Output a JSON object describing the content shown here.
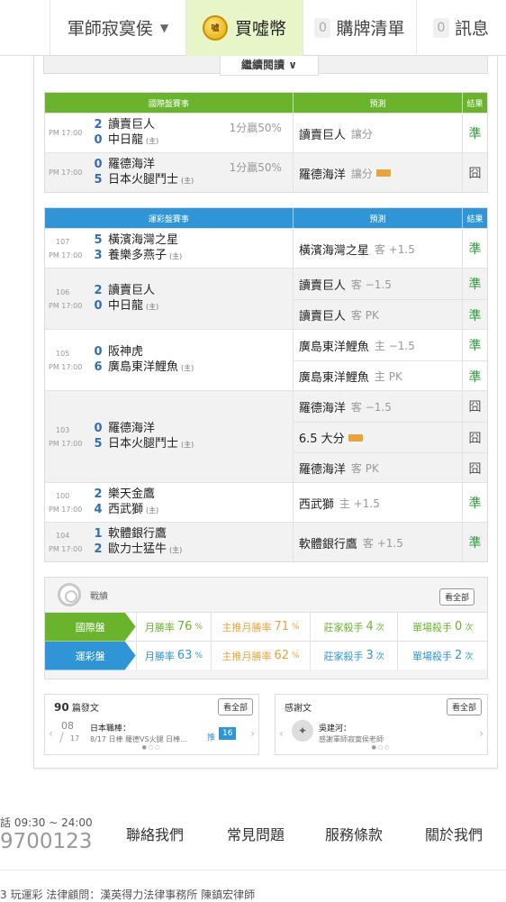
{
  "nav": {
    "user": "軍師寂寞侯",
    "buy_label": "買噓幣",
    "coin_text": "噓",
    "cart_count": "0",
    "cart_label": "購牌清單",
    "msg_count": "0",
    "msg_label": "訊息"
  },
  "read_more": "繼續閱讀",
  "intl": {
    "header": {
      "game": "國際盤賽事",
      "pred": "預測",
      "result": "結果"
    },
    "rows": [
      {
        "time": "PM 17:00",
        "s1": "2",
        "t1": "讀賣巨人",
        "s2": "0",
        "t2": "中日龍",
        "home": "(主)",
        "odds": "1分贏50%",
        "preds": [
          {
            "pick": "讀賣巨人",
            "sub": "讓分",
            "badge": false,
            "result": "準",
            "win": true
          }
        ]
      },
      {
        "time": "PM 17:00",
        "s1": "0",
        "t1": "羅德海洋",
        "s2": "5",
        "t2": "日本火腿鬥士",
        "home": "(主)",
        "odds": "1分贏50%",
        "preds": [
          {
            "pick": "羅德海洋",
            "sub": "讓分",
            "badge": true,
            "result": "囧",
            "win": false
          }
        ]
      }
    ]
  },
  "lottery": {
    "header": {
      "game": "運彩盤賽事",
      "pred": "預測",
      "result": "結果"
    },
    "rows": [
      {
        "num": "107",
        "time": "PM 17:00",
        "s1": "5",
        "t1": "橫濱海灣之星",
        "s2": "3",
        "t2": "養樂多燕子",
        "home": "(主)",
        "preds": [
          {
            "pick": "橫濱海灣之星",
            "sub": "客 +1.5",
            "result": "準"
          }
        ]
      },
      {
        "num": "106",
        "time": "PM 17:00",
        "s1": "2",
        "t1": "讀賣巨人",
        "s2": "0",
        "t2": "中日龍",
        "home": "(主)",
        "preds": [
          {
            "pick": "讀賣巨人",
            "sub": "客 −1.5",
            "result": "準"
          },
          {
            "pick": "讀賣巨人",
            "sub": "客 PK",
            "result": "準"
          }
        ]
      },
      {
        "num": "105",
        "time": "PM 17:00",
        "s1": "0",
        "t1": "阪神虎",
        "s2": "6",
        "t2": "廣島東洋鯉魚",
        "home": "(主)",
        "preds": [
          {
            "pick": "廣島東洋鯉魚",
            "sub": "主 −1.5",
            "result": "準"
          },
          {
            "pick": "廣島東洋鯉魚",
            "sub": "主 PK",
            "result": "準"
          }
        ]
      },
      {
        "num": "103",
        "time": "PM 17:00",
        "s1": "0",
        "t1": "羅德海洋",
        "s2": "5",
        "t2": "日本火腿鬥士",
        "home": "(主)",
        "preds": [
          {
            "pick": "羅德海洋",
            "sub": "客 −1.5",
            "result": "囧"
          },
          {
            "pick": "6.5 大分",
            "sub": "",
            "badge": true,
            "result": "囧"
          },
          {
            "pick": "羅德海洋",
            "sub": "客 PK",
            "result": "囧"
          }
        ]
      },
      {
        "num": "100",
        "time": "PM 17:00",
        "s1": "2",
        "t1": "樂天金鷹",
        "s2": "4",
        "t2": "西武獅",
        "home": "(主)",
        "preds": [
          {
            "pick": "西武獅",
            "sub": "主 +1.5",
            "result": "準"
          }
        ]
      },
      {
        "num": "104",
        "time": "PM 17:00",
        "s1": "1",
        "t1": "軟體銀行鷹",
        "s2": "2",
        "t2": "歐力士猛牛",
        "home": "(主)",
        "preds": [
          {
            "pick": "軟體銀行鷹",
            "sub": "客 +1.5",
            "result": "準"
          }
        ]
      }
    ]
  },
  "record": {
    "title": "戰績",
    "see_all": "看全部",
    "rows": [
      {
        "label": "國際盤",
        "color": "#6ab42d",
        "monthly": "76",
        "main_monthly": "71",
        "banker": "4",
        "single": "0"
      },
      {
        "label": "運彩盤",
        "color": "#2f95d6",
        "monthly": "63",
        "main_monthly": "62",
        "banker": "3",
        "single": "2"
      }
    ],
    "labels": {
      "monthly": "月勝率",
      "main_monthly": "主推月勝率",
      "banker": "莊家殺手",
      "single": "單場殺手",
      "pct": "%",
      "times": "次"
    }
  },
  "posts": {
    "count": "90",
    "title": "篇發文",
    "see_all": "看全部",
    "month": "08",
    "day": "17",
    "item_title": "日本職棒：",
    "item_desc": "8/17 日棒 羅德VS火腿 日棒...",
    "push_label": "推",
    "push_count": "16"
  },
  "thanks": {
    "title": "感謝文",
    "see_all": "看全部",
    "author": "吳建河：",
    "text": "感謝軍師寂寞侯老師"
  },
  "footer": {
    "hours": "話 09:30 ~ 24:00",
    "phone": "9700123",
    "links": [
      "聯絡我們",
      "常見問題",
      "服務條款",
      "關於我們"
    ],
    "legal": "3 玩運彩 法律顧問：漢英得力法律事務所 陳鎮宏律師"
  },
  "colors": {
    "green": "#6ab42d",
    "blue": "#2f95d6",
    "win": "#2e9e3a",
    "orange": "#e8a33b"
  }
}
